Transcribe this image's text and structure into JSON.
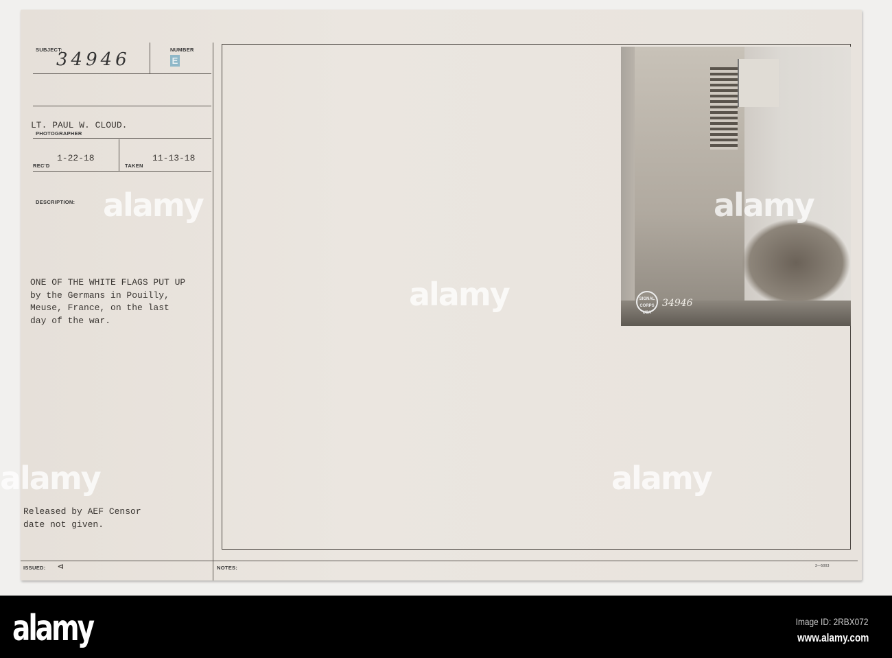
{
  "card": {
    "subject_label": "SUBJECT:",
    "subject_value": "34946",
    "number_label": "NUMBER",
    "number_stamp": "E",
    "photographer_value": "LT. PAUL W. CLOUD.",
    "photographer_label": "PHOTOGRAPHER",
    "recd_label": "REC'D",
    "recd_value": "1-22-18",
    "taken_label": "TAKEN",
    "taken_value": "11-13-18",
    "description_label": "DESCRIPTION:",
    "description_lines": [
      "ONE OF THE WHITE FLAGS PUT UP",
      "by the Germans in Pouilly,",
      "Meuse, France, on the last",
      "day of the war."
    ],
    "release_lines": [
      "Released by AEF Censor",
      "date not given."
    ],
    "issued_label": "ISSUED:",
    "issued_mark": "⊲",
    "notes_label": "NOTES:",
    "form_code": "3—5003"
  },
  "photo": {
    "negative_number": "34946",
    "seal_text": "SIGNAL CORPS USA"
  },
  "watermark": {
    "text": "alamy",
    "small": "a"
  },
  "footer": {
    "logo": "alamy",
    "image_id": "Image ID: 2RBX072",
    "url": "www.alamy.com"
  }
}
